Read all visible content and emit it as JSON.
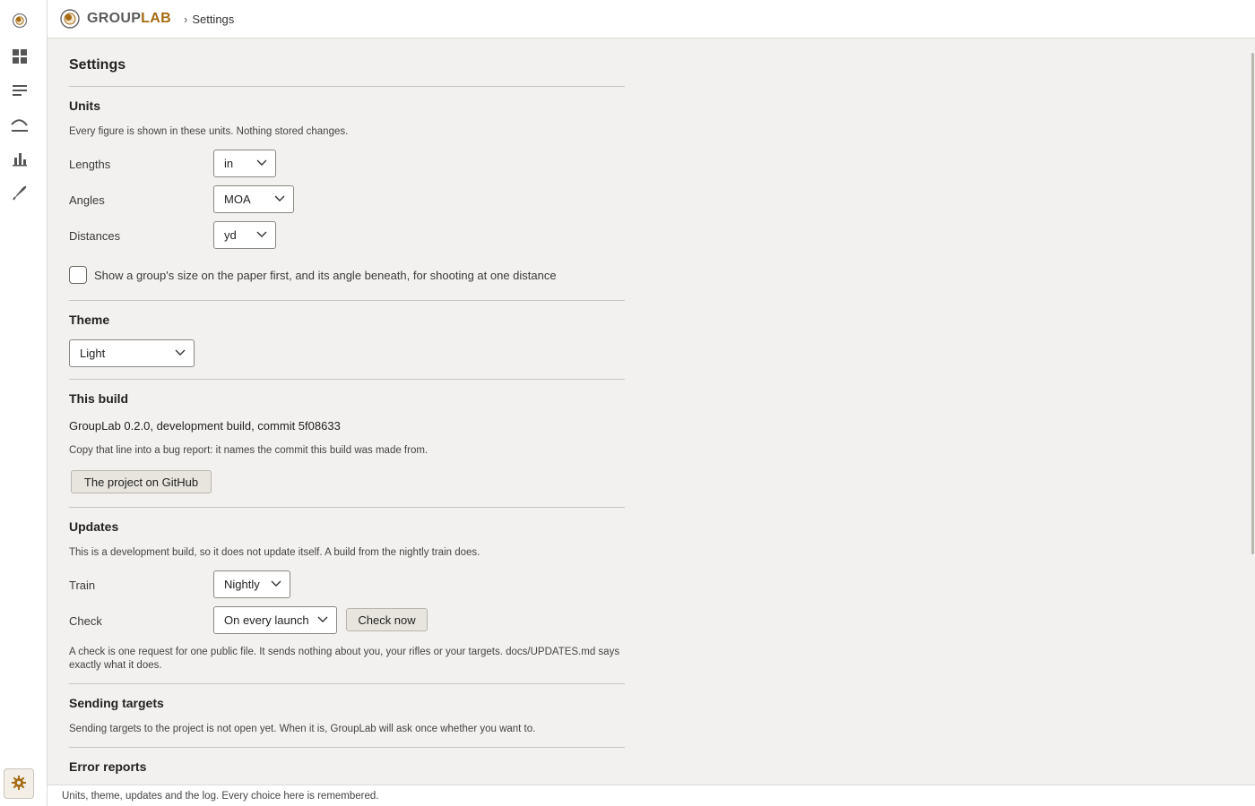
{
  "app": {
    "brand_part1": "GROUP",
    "brand_part2": "LAB",
    "breadcrumb_sep": "›",
    "breadcrumb": "Settings"
  },
  "nav": {
    "items": [
      {
        "icon": "logo-icon"
      },
      {
        "icon": "dashboard-icon"
      },
      {
        "icon": "list-icon"
      },
      {
        "icon": "trajectory-icon"
      },
      {
        "icon": "chart-icon"
      },
      {
        "icon": "bullet-icon"
      }
    ],
    "settings_icon": "gear-icon"
  },
  "page": {
    "title": "Settings"
  },
  "units": {
    "heading": "Units",
    "note": "Every figure is shown in these units. Nothing stored changes.",
    "lengths_label": "Lengths",
    "lengths_value": "in",
    "angles_label": "Angles",
    "angles_value": "MOA",
    "distances_label": "Distances",
    "distances_value": "yd",
    "checkbox_label": "Show a group's size on the paper first, and its angle beneath, for shooting at one distance",
    "checkbox_checked": false
  },
  "theme": {
    "heading": "Theme",
    "value": "Light"
  },
  "build": {
    "heading": "This build",
    "line": "GroupLab 0.2.0, development build, commit 5f08633",
    "note": "Copy that line into a bug report: it names the commit this build was made from.",
    "github_button": "The project on GitHub"
  },
  "updates": {
    "heading": "Updates",
    "note": "This is a development build, so it does not update itself. A build from the nightly train does.",
    "train_label": "Train",
    "train_value": "Nightly",
    "check_label": "Check",
    "check_value": "On every launch",
    "check_now_button": "Check now",
    "footnote_line1": "A check is one request for one public file. It sends nothing about you, your rifles or your targets. docs/UPDATES.md says",
    "footnote_line2": "exactly what it does."
  },
  "sending": {
    "heading": "Sending targets",
    "note": "Sending targets to the project is not open yet. When it is, GroupLab will ask once whether you want to."
  },
  "errors": {
    "heading": "Error reports"
  },
  "footer": {
    "text": "Units, theme, updates and the log. Every choice here is remembered."
  },
  "colors": {
    "accent": "#a56a12",
    "background": "#f2f1ef"
  }
}
